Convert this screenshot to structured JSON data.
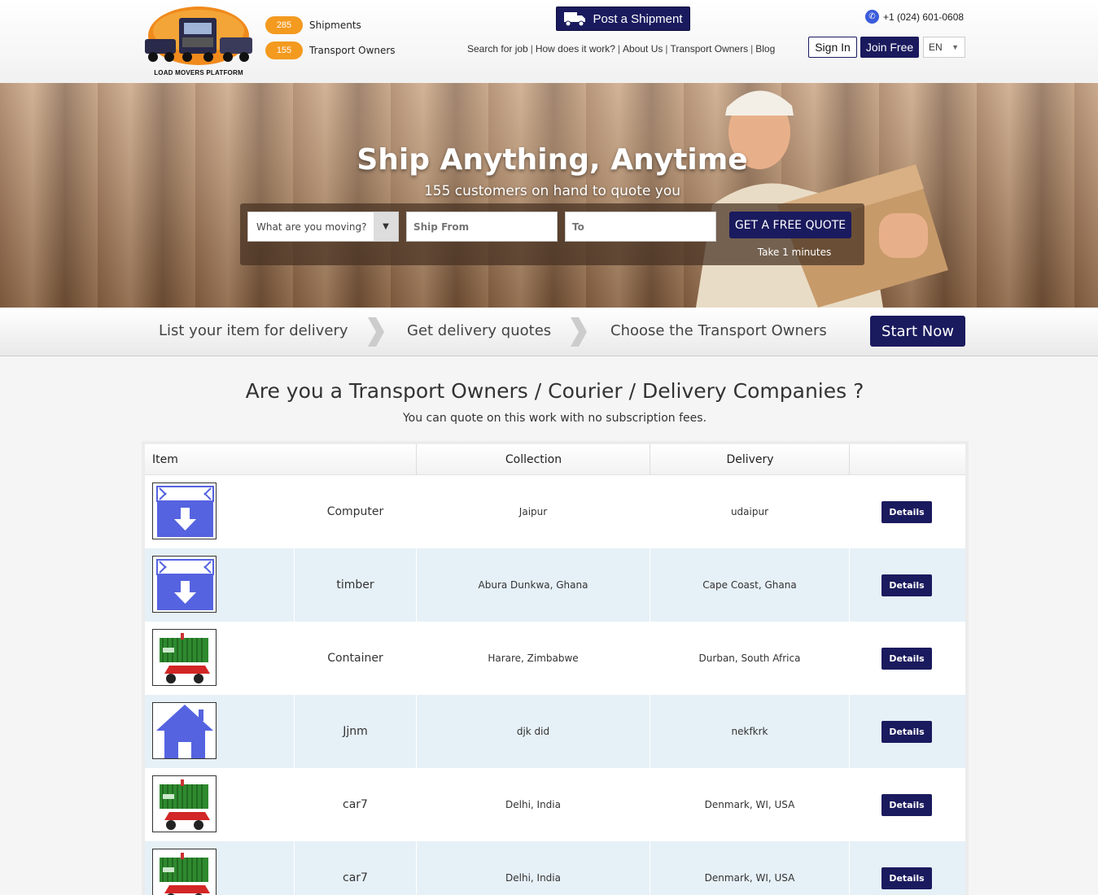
{
  "header": {
    "logo_text": "LOAD MOVERS PLATFORM",
    "stats": [
      {
        "count": "285",
        "label": "Shipments"
      },
      {
        "count": "155",
        "label": "Transport Owners"
      }
    ],
    "post_button": "Post a Shipment",
    "nav": [
      "Search for job",
      "How does it work?",
      "About Us",
      "Transport Owners",
      "Blog"
    ],
    "phone": "+1 (024) 601-0608",
    "signin": "Sign In",
    "joinfree": "Join Free",
    "language": "EN"
  },
  "hero": {
    "title": "Ship Anything, Anytime",
    "subtitle": "155 customers on hand to quote you",
    "select_placeholder": "What are you moving?",
    "from_placeholder": "Ship From",
    "to_placeholder": "To",
    "quote_button": "GET A FREE QUOTE",
    "take_note": "Take 1 minutes"
  },
  "steps": {
    "items": [
      "List your item for delivery",
      "Get delivery quotes",
      "Choose the Transport Owners"
    ],
    "start_button": "Start Now"
  },
  "section": {
    "title": "Are you a Transport Owners / Courier / Delivery Companies ?",
    "subtitle": "You can quote on this work with no subscription fees."
  },
  "table": {
    "headers": {
      "item": "Item",
      "collection": "Collection",
      "delivery": "Delivery"
    },
    "details_label": "Details",
    "rows": [
      {
        "name": "Computer",
        "collection": "Jaipur",
        "delivery": "udaipur",
        "icon": "box-down-icon"
      },
      {
        "name": "timber",
        "collection": "Abura Dunkwa, Ghana",
        "delivery": "Cape Coast, Ghana",
        "icon": "box-down-icon"
      },
      {
        "name": "Container",
        "collection": "Harare, Zimbabwe",
        "delivery": "Durban, South Africa",
        "icon": "container-icon"
      },
      {
        "name": "Jjnm",
        "collection": "djk did",
        "delivery": "nekfkrk",
        "icon": "house-icon"
      },
      {
        "name": "car7",
        "collection": "Delhi, India",
        "delivery": "Denmark, WI, USA",
        "icon": "container-icon"
      },
      {
        "name": "car7",
        "collection": "Delhi, India",
        "delivery": "Denmark, WI, USA",
        "icon": "container-icon"
      }
    ]
  },
  "colors": {
    "navy": "#1a1a5e",
    "orange": "#f39a1f",
    "row_alt": "#e6f0f7",
    "icon_blue": "#5563e0"
  }
}
